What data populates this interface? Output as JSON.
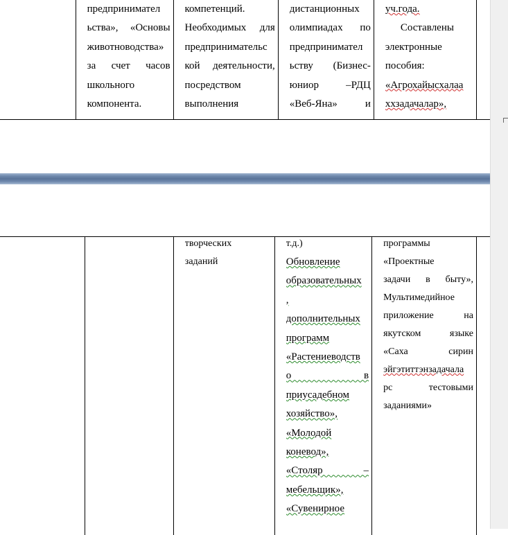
{
  "top_page": {
    "col2": [
      "предпринимател",
      "ьства», «Основы",
      "животноводства»",
      "за счет часов",
      "школьного",
      "компонента."
    ],
    "col3": [
      "компетенций.",
      "Необходимых для",
      "предпринимательс",
      "кой деятельности,",
      "посредством",
      "выполнения"
    ],
    "col4": [
      "дистанционных",
      "олимпиадах по",
      "предпринимател",
      "ьству (Бизнес-",
      "юниор –РДЦ",
      "«Веб-Яна» и"
    ],
    "col5": [
      "уч.года.",
      "Составлены",
      "электронные",
      "пособия:",
      "«Агрохайысхалаа",
      "ххзадачалар»,"
    ]
  },
  "bottom_page": {
    "col3": [
      "творческих",
      "заданий"
    ],
    "col4": [
      "т.д.)",
      "Обновление",
      "образовательных",
      ",",
      "дополнительных",
      "программ",
      "«Растениеводств",
      "о в",
      "приусадебном",
      "хозяйство»,",
      "«Молодой",
      "коневод»,",
      "«Столяр –",
      "мебельщик»,",
      "«Сувенирное"
    ],
    "col5": [
      "программы",
      "«Проектные",
      "задачи в быту»,",
      "Мультимедийное",
      "приложение на",
      "якутском языке",
      "«Саха сирин",
      "эйгэтиттэнзадачала",
      "рс тестовыми",
      "заданиями»"
    ]
  }
}
